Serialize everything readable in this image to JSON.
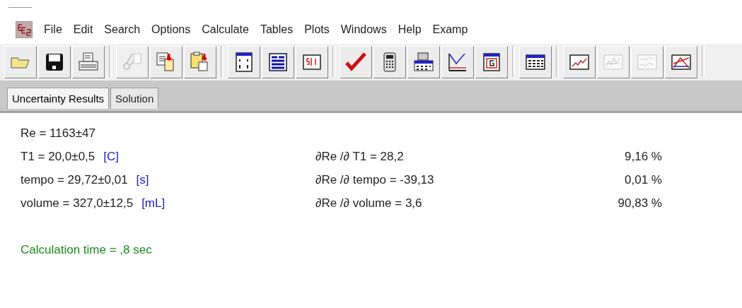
{
  "menu": {
    "items": [
      "File",
      "Edit",
      "Search",
      "Options",
      "Calculate",
      "Tables",
      "Plots",
      "Windows",
      "Help",
      "Examp"
    ]
  },
  "toolbar": {
    "groups": [
      [
        {
          "kind": "open",
          "disabled": false
        },
        {
          "kind": "save",
          "disabled": false
        },
        {
          "kind": "print",
          "disabled": false
        }
      ],
      [
        {
          "kind": "cut",
          "disabled": true
        },
        {
          "kind": "copy",
          "disabled": false
        },
        {
          "kind": "paste",
          "disabled": false
        }
      ],
      [
        {
          "kind": "equations",
          "disabled": false
        },
        {
          "kind": "formatted",
          "disabled": false
        },
        {
          "kind": "units",
          "disabled": false
        }
      ],
      [
        {
          "kind": "check",
          "disabled": false
        },
        {
          "kind": "calculator",
          "disabled": false
        },
        {
          "kind": "solve-table",
          "disabled": false
        },
        {
          "kind": "min-max",
          "disabled": false
        },
        {
          "kind": "diagram",
          "disabled": false
        }
      ],
      [
        {
          "kind": "table",
          "disabled": false
        }
      ],
      [
        {
          "kind": "plot",
          "disabled": false
        },
        {
          "kind": "plot2",
          "disabled": true
        },
        {
          "kind": "plot3",
          "disabled": true
        },
        {
          "kind": "plot4",
          "disabled": false
        }
      ]
    ]
  },
  "tabs": [
    {
      "label": "Uncertainty Results",
      "selected": true
    },
    {
      "label": "Solution",
      "selected": false
    }
  ],
  "results": {
    "rows": [
      {
        "variable": "Re  = 1163±47"
      },
      {
        "variable": "T1  = 20,0±0,5",
        "unit": "[C]",
        "partial": "∂Re /∂ T1  = 28,2",
        "percent": "9,16 %"
      },
      {
        "variable": "tempo  = 29,72±0,01",
        "unit": "[s]",
        "partial": "∂Re /∂ tempo  = -39,13",
        "percent": "0,01 %"
      },
      {
        "variable": "volume  = 327,0±12,5",
        "unit": "[mL]",
        "partial": "∂Re /∂ volume  = 3,6",
        "percent": "90,83 %"
      }
    ],
    "calculation_time": "Calculation time = ,8 sec"
  }
}
